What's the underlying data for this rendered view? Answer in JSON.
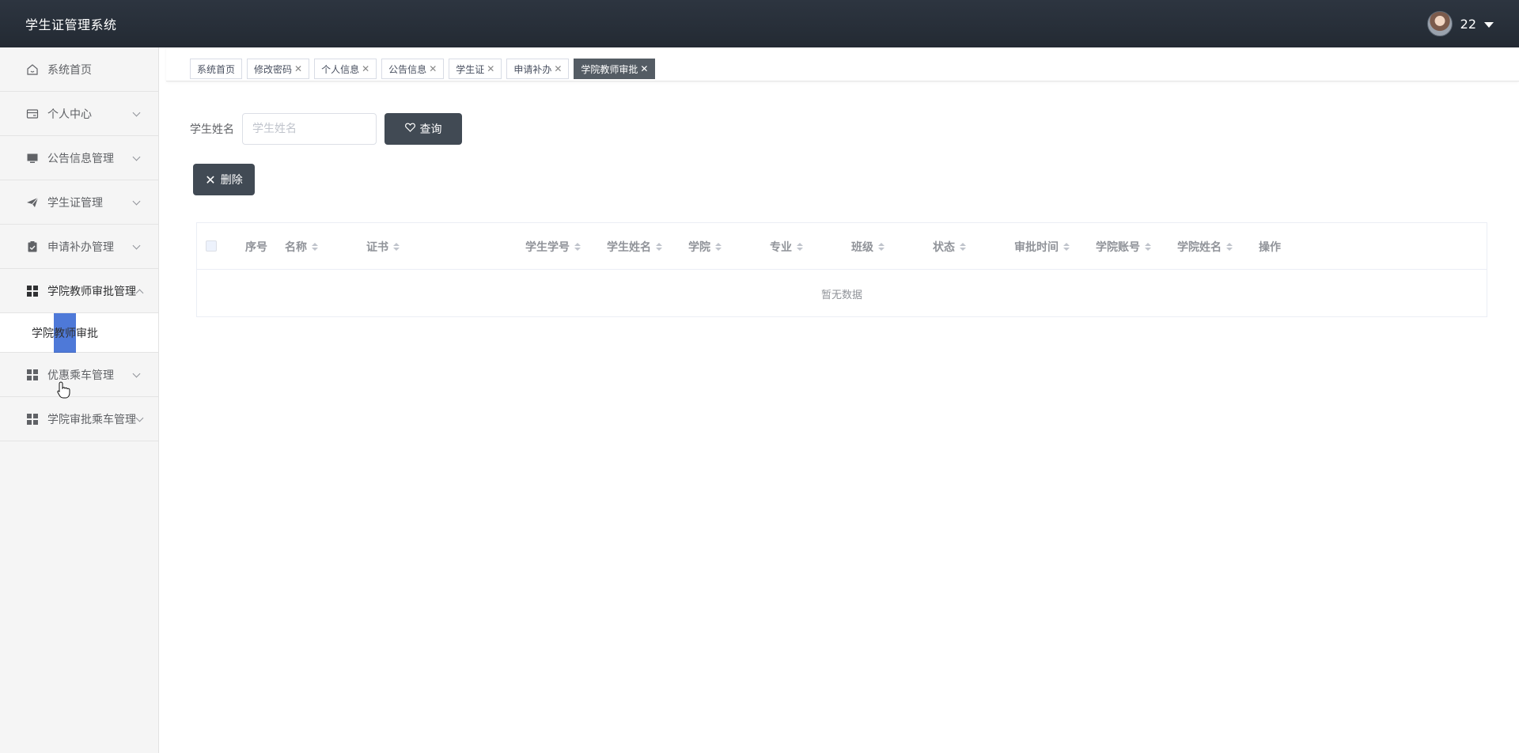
{
  "app": {
    "title": "学生证管理系统",
    "username": "22"
  },
  "sidebar": {
    "items": [
      {
        "label": "系统首页",
        "icon": "home-icon"
      },
      {
        "label": "个人中心",
        "icon": "card-icon"
      },
      {
        "label": "公告信息管理",
        "icon": "monitor-icon"
      },
      {
        "label": "学生证管理",
        "icon": "send-icon"
      },
      {
        "label": "申请补办管理",
        "icon": "clipboard-icon"
      },
      {
        "label": "学院教师审批管理",
        "icon": "grid-icon",
        "expanded": true
      },
      {
        "label": "优惠乘车管理",
        "icon": "grid-icon"
      },
      {
        "label": "学院审批乘车管理",
        "icon": "grid-icon"
      }
    ],
    "submenu": {
      "label": "学院教师审批"
    }
  },
  "tabs": [
    {
      "label": "系统首页",
      "closable": false
    },
    {
      "label": "修改密码",
      "closable": true
    },
    {
      "label": "个人信息",
      "closable": true
    },
    {
      "label": "公告信息",
      "closable": true
    },
    {
      "label": "学生证",
      "closable": true
    },
    {
      "label": "申请补办",
      "closable": true
    },
    {
      "label": "学院教师审批",
      "closable": true,
      "active": true
    }
  ],
  "search": {
    "label": "学生姓名",
    "placeholder": "学生姓名",
    "value": "",
    "button": "查询"
  },
  "actions": {
    "delete": "删除"
  },
  "table": {
    "columns": [
      "序号",
      "名称",
      "证书",
      "学生学号",
      "学生姓名",
      "学院",
      "专业",
      "班级",
      "状态",
      "审批时间",
      "学院账号",
      "学院姓名",
      "操作"
    ],
    "empty_text": "暂无数据"
  },
  "colors": {
    "header_bg": "#2a313b",
    "button_bg": "#414a54",
    "active_tab": "#545c64",
    "highlight": "#3a6ad4"
  }
}
